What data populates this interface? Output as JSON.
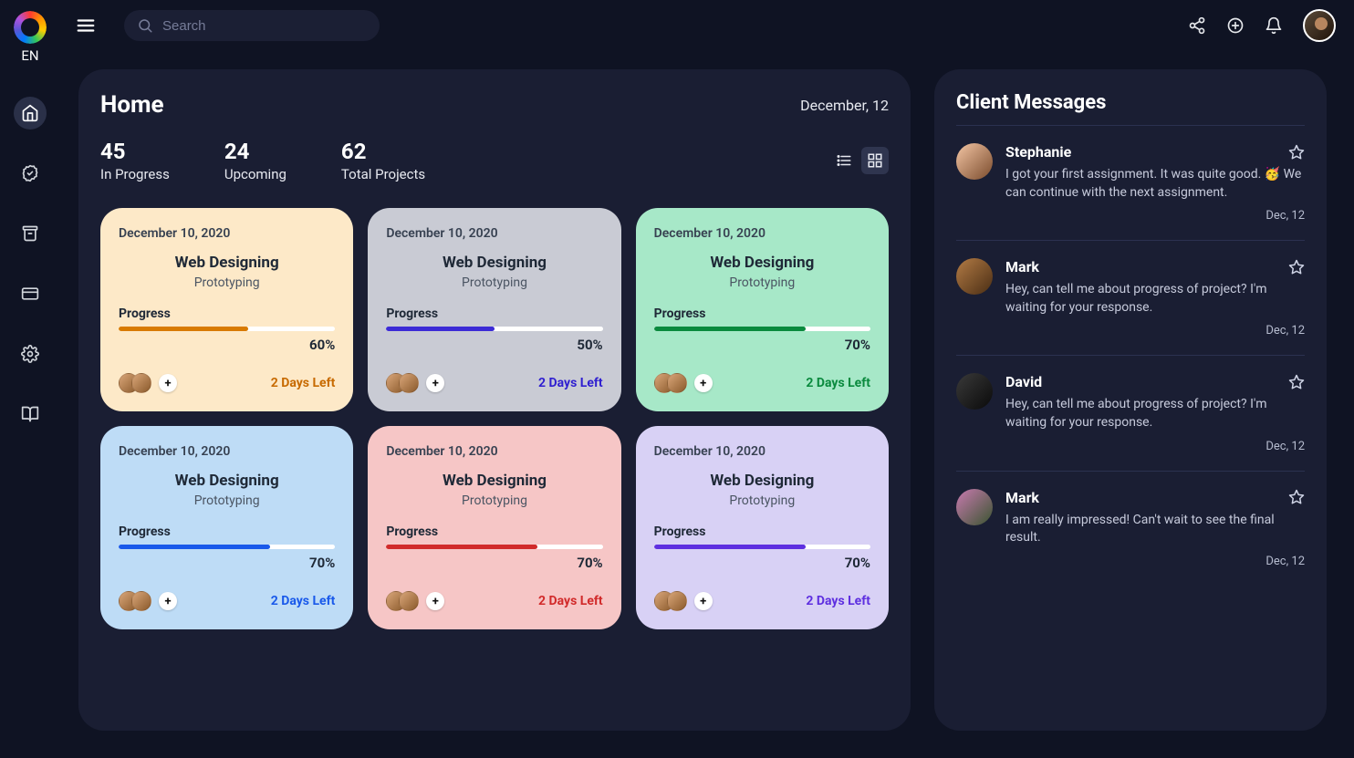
{
  "lang": "EN",
  "search": {
    "placeholder": "Search"
  },
  "header": {
    "title": "Home",
    "date": "December, 12"
  },
  "stats": [
    {
      "value": "45",
      "label": "In Progress"
    },
    {
      "value": "24",
      "label": "Upcoming"
    },
    {
      "value": "62",
      "label": "Total Projects"
    }
  ],
  "cards": [
    {
      "date": "December 10, 2020",
      "title": "Web Designing",
      "sub": "Prototyping",
      "progress_label": "Progress",
      "progress": 60,
      "pct": "60%",
      "days_left": "2 Days Left",
      "color": "c-orange"
    },
    {
      "date": "December 10, 2020",
      "title": "Web Designing",
      "sub": "Prototyping",
      "progress_label": "Progress",
      "progress": 50,
      "pct": "50%",
      "days_left": "2 Days Left",
      "color": "c-gray"
    },
    {
      "date": "December 10, 2020",
      "title": "Web Designing",
      "sub": "Prototyping",
      "progress_label": "Progress",
      "progress": 70,
      "pct": "70%",
      "days_left": "2 Days Left",
      "color": "c-green"
    },
    {
      "date": "December 10, 2020",
      "title": "Web Designing",
      "sub": "Prototyping",
      "progress_label": "Progress",
      "progress": 70,
      "pct": "70%",
      "days_left": "2 Days Left",
      "color": "c-blue"
    },
    {
      "date": "December 10, 2020",
      "title": "Web Designing",
      "sub": "Prototyping",
      "progress_label": "Progress",
      "progress": 70,
      "pct": "70%",
      "days_left": "2 Days Left",
      "color": "c-red"
    },
    {
      "date": "December 10, 2020",
      "title": "Web Designing",
      "sub": "Prototyping",
      "progress_label": "Progress",
      "progress": 70,
      "pct": "70%",
      "days_left": "2 Days Left",
      "color": "c-purple"
    }
  ],
  "messages": {
    "title": "Client Messages",
    "items": [
      {
        "name": "Stephanie",
        "text": "I got your first assignment. It was quite good. 🥳 We can continue with the next assignment.",
        "date": "Dec, 12",
        "avatar": "linear-gradient(135deg,#f4c6a5,#7a4b2c)"
      },
      {
        "name": "Mark",
        "text": "Hey, can tell me about progress of project? I'm waiting for your response.",
        "date": "Dec, 12",
        "avatar": "linear-gradient(135deg,#b37b45,#4a2e14)"
      },
      {
        "name": "David",
        "text": "Hey, can tell me about progress of project? I'm waiting for your response.",
        "date": "Dec, 12",
        "avatar": "linear-gradient(135deg,#3a3a3a,#0a0a0a)"
      },
      {
        "name": "Mark",
        "text": "I am really impressed! Can't wait to see the final result.",
        "date": "Dec, 12",
        "avatar": "linear-gradient(135deg,#c97ab0,#3a5530)"
      }
    ]
  }
}
